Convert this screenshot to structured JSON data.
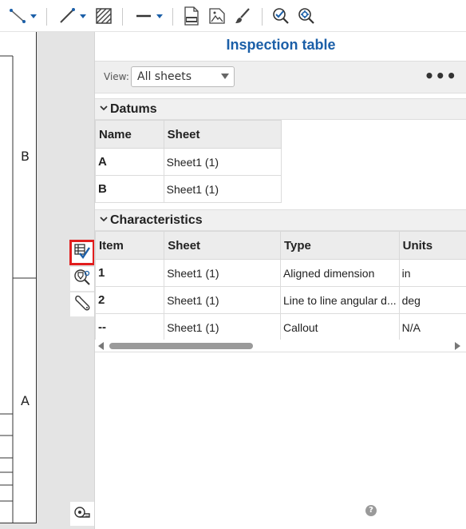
{
  "panel": {
    "title": "Inspection table",
    "view_label": "View:",
    "view_value": "All sheets",
    "more_menu": "•••"
  },
  "datums": {
    "heading": "Datums",
    "columns": [
      "Name",
      "Sheet"
    ],
    "rows": [
      [
        "A",
        "Sheet1 (1)"
      ],
      [
        "B",
        "Sheet1 (1)"
      ]
    ]
  },
  "characteristics": {
    "heading": "Characteristics",
    "columns": [
      "Item",
      "Sheet",
      "Type",
      "Units"
    ],
    "rows": [
      [
        "1",
        "Sheet1 (1)",
        "Aligned dimension",
        "in"
      ],
      [
        "2",
        "Sheet1 (1)",
        "Line to line angular d...",
        "deg"
      ],
      [
        "--",
        "Sheet1 (1)",
        "Callout",
        "N/A"
      ]
    ]
  },
  "drawing": {
    "zone_b": "B",
    "zone_a": "A"
  },
  "help": "?",
  "colors": {
    "title_blue": "#1b5fa8",
    "active_highlight": "#e11d1d",
    "accent_icon": "#1b5fa8"
  },
  "icons": {
    "toolbar": [
      "connector-line-icon",
      "dropdown-caret-icon",
      "line-icon",
      "dropdown-caret-icon",
      "hatch-icon",
      "line-weight-icon",
      "dropdown-caret-icon",
      "export-dxf-icon",
      "insert-image-icon",
      "brush-icon",
      "inspection-check-icon",
      "inspection-settings-icon"
    ],
    "strip": [
      "inspection-table-icon",
      "balloon-settings-icon",
      "wrench-icon",
      "tape-measure-icon"
    ]
  }
}
